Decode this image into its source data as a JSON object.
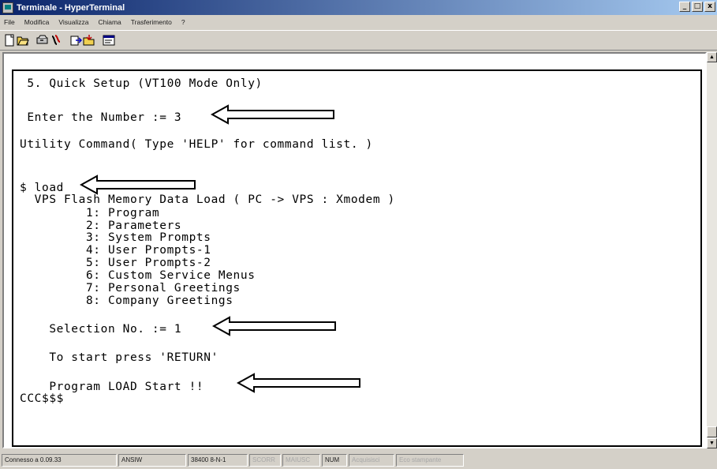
{
  "window": {
    "title": "Terminale - HyperTerminal",
    "buttons": {
      "minimize": "_",
      "maximize": "□",
      "close": "x"
    }
  },
  "menubar": {
    "items": [
      "File",
      "Modifica",
      "Visualizza",
      "Chiama",
      "Trasferimento",
      "?"
    ]
  },
  "toolbar": {
    "icons": [
      "new-connection-icon",
      "open-icon",
      "connect-icon",
      "disconnect-icon",
      "send-icon",
      "receive-icon",
      "properties-icon"
    ]
  },
  "terminal": {
    "lines": [
      " 5. Quick Setup (VT100 Mode Only)",
      " Enter the Number := 3",
      "Utility Command( Type 'HELP' for command list. )",
      "$ load",
      "  VPS Flash Memory Data Load ( PC -> VPS : Xmodem )",
      "         1: Program",
      "         2: Parameters",
      "         3: System Prompts",
      "         4: User Prompts-1",
      "         5: User Prompts-2",
      "         6: Custom Service Menus",
      "         7: Personal Greetings",
      "         8: Company Greetings",
      "    Selection No. := 1",
      "    To start press 'RETURN'",
      "    Program LOAD Start !!",
      "CCC$$$"
    ]
  },
  "statusbar": {
    "connected": "Connesso a 0.09.33",
    "emulation": "ANSIW",
    "port_settings": "38400 8-N-1",
    "scroll": "SCORR",
    "caps": "MAIUSC",
    "num": "NUM",
    "capture": "Acquisisci",
    "echo": "Eco stampante"
  },
  "colors": {
    "titlebar_start": "#0a246a",
    "titlebar_end": "#a6caf0",
    "chrome": "#d4d0c8",
    "terminal_bg": "#ffffff",
    "terminal_text": "#000000"
  }
}
